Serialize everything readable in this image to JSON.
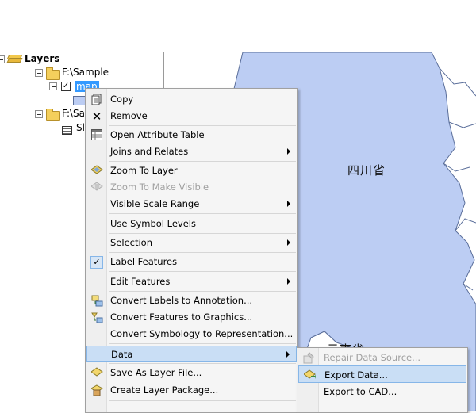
{
  "toc": {
    "layers_label": "Layers",
    "items": [
      {
        "label": "F:\\Sample"
      },
      {
        "label": "map"
      },
      {
        "label": "F:\\Sa"
      },
      {
        "label": "Sl"
      }
    ]
  },
  "map": {
    "label_sichuan": "四川省",
    "label_yunnan": "云南省",
    "fill_color": "#bccdf3",
    "outline_color": "#5a6e9a"
  },
  "context_menu": {
    "items": [
      {
        "label": "Copy",
        "icon": "copy-icon"
      },
      {
        "label": "Remove",
        "icon": "remove-icon"
      },
      {
        "label": "Open Attribute Table",
        "icon": "table-icon"
      },
      {
        "label": "Joins and Relates"
      },
      {
        "label": "Zoom To Layer",
        "icon": "zoom-to-layer-icon"
      },
      {
        "label": "Zoom To Make Visible",
        "icon": "zoom-visible-icon",
        "disabled": true
      },
      {
        "label": "Visible Scale Range"
      },
      {
        "label": "Use Symbol Levels"
      },
      {
        "label": "Selection"
      },
      {
        "label": "Label Features",
        "icon": "checkmark-icon"
      },
      {
        "label": "Edit Features"
      },
      {
        "label": "Convert Labels to Annotation...",
        "icon": "annotation-icon"
      },
      {
        "label": "Convert Features to Graphics...",
        "icon": "graphics-icon"
      },
      {
        "label": "Convert Symbology to Representation..."
      },
      {
        "label": "Data"
      },
      {
        "label": "Save As Layer File...",
        "icon": "layer-file-icon"
      },
      {
        "label": "Create Layer Package...",
        "icon": "layer-package-icon"
      }
    ]
  },
  "submenu": {
    "items": [
      {
        "label": "Repair Data Source...",
        "icon": "repair-icon",
        "disabled": true
      },
      {
        "label": "Export Data...",
        "icon": "export-icon"
      },
      {
        "label": "Export to CAD..."
      }
    ]
  }
}
